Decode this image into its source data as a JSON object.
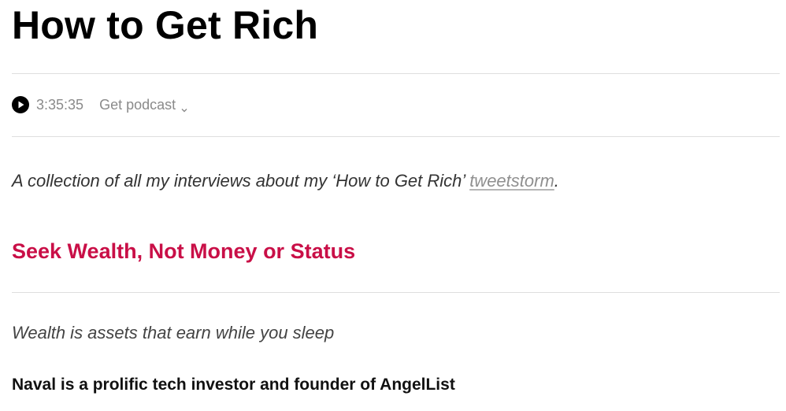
{
  "page": {
    "title": "How to Get Rich"
  },
  "player": {
    "play_icon": "play-icon",
    "duration": "3:35:35",
    "get_podcast_label": "Get podcast",
    "dropdown_icon": "chevron-down-icon"
  },
  "intro": {
    "text_before": "A collection of all my interviews about my ‘How to Get Rich’ ",
    "link_text": "tweetstorm",
    "text_after": "."
  },
  "section": {
    "heading": "Seek Wealth, Not Money or Status",
    "subtitle": "Wealth is assets that earn while you sleep",
    "body": "Naval is a prolific tech investor and founder of AngelList"
  },
  "colors": {
    "heading_accent": "#c90f47",
    "muted_text": "#8a8a8a",
    "divider": "#dedede"
  }
}
